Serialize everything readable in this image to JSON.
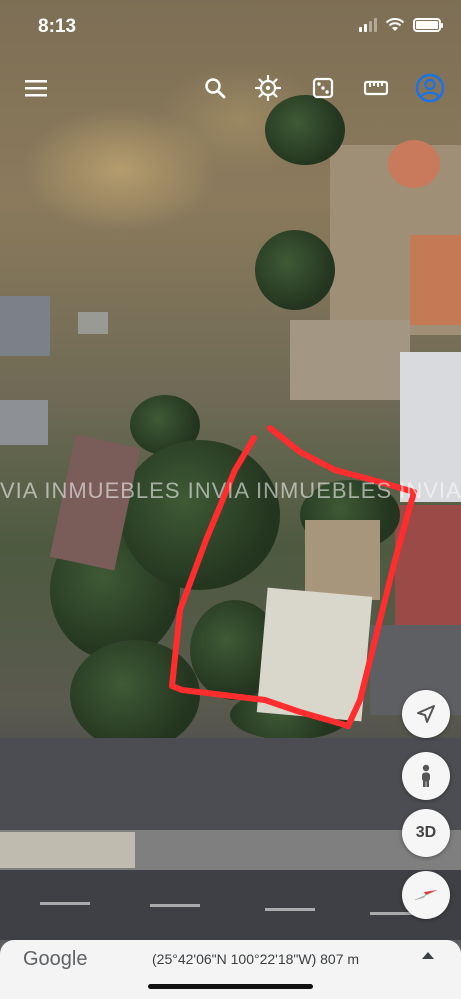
{
  "status_bar": {
    "time": "8:13"
  },
  "watermark": {
    "text": "VIA INMUEBLES INVIA INMUEBLES INVIA INMUEBLES"
  },
  "toolbar": {
    "icons": [
      "menu-icon",
      "search-icon",
      "voyager-wheel-icon",
      "dice-icon",
      "ruler-icon",
      "account-icon"
    ]
  },
  "map_controls": {
    "compass_label": "",
    "three_d_label": "3D"
  },
  "bottom_bar": {
    "logo": "Google",
    "coordinates": "(25°42'06\"N 100°22'18\"W) 807 m"
  },
  "colors": {
    "annotation_outline": "#ff2d2d",
    "account_icon": "#1a73e8",
    "compass_red": "#e53935"
  }
}
